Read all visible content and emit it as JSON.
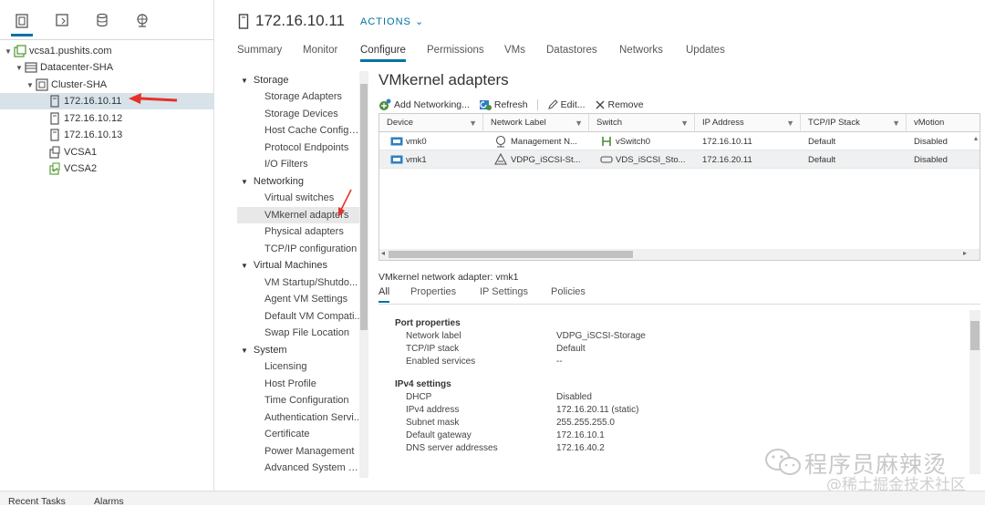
{
  "tree": {
    "vcenter": "vcsa1.pushits.com",
    "datacenter": "Datacenter-SHA",
    "cluster": "Cluster-SHA",
    "hosts": [
      "172.16.10.11",
      "172.16.10.12",
      "172.16.10.13"
    ],
    "vms": [
      "VCSA1",
      "VCSA2"
    ]
  },
  "header": {
    "title": "172.16.10.11",
    "actions": "ACTIONS"
  },
  "tabs": [
    "Summary",
    "Monitor",
    "Configure",
    "Permissions",
    "VMs",
    "Datastores",
    "Networks",
    "Updates"
  ],
  "nav": {
    "storage": {
      "label": "Storage",
      "items": [
        "Storage Adapters",
        "Storage Devices",
        "Host Cache Configur...",
        "Protocol Endpoints",
        "I/O Filters"
      ]
    },
    "networking": {
      "label": "Networking",
      "items": [
        "Virtual switches",
        "VMkernel adapters",
        "Physical adapters",
        "TCP/IP configuration"
      ]
    },
    "virtual_machines": {
      "label": "Virtual Machines",
      "items": [
        "VM Startup/Shutdo...",
        "Agent VM Settings",
        "Default VM Compati...",
        "Swap File Location"
      ]
    },
    "system": {
      "label": "System",
      "items": [
        "Licensing",
        "Host Profile",
        "Time Configuration",
        "Authentication Servi...",
        "Certificate",
        "Power Management",
        "Advanced System S..."
      ]
    }
  },
  "panel": {
    "title": "VMkernel adapters",
    "toolbar": {
      "add": "Add Networking...",
      "refresh": "Refresh",
      "edit": "Edit...",
      "remove": "Remove"
    }
  },
  "grid": {
    "columns": [
      "Device",
      "Network Label",
      "Switch",
      "IP Address",
      "TCP/IP Stack",
      "vMotion"
    ],
    "rows": [
      [
        "vmk0",
        "Management N...",
        "vSwitch0",
        "172.16.10.11",
        "Default",
        "Disabled"
      ],
      [
        "vmk1",
        "VDPG_iSCSI-St...",
        "VDS_iSCSI_Sto...",
        "172.16.20.11",
        "Default",
        "Disabled"
      ]
    ]
  },
  "detail": {
    "title": "VMkernel network adapter: vmk1",
    "tabs": [
      "All",
      "Properties",
      "IP Settings",
      "Policies"
    ],
    "port_heading": "Port properties",
    "port": [
      {
        "k": "Network label",
        "v": "VDPG_iSCSI-Storage"
      },
      {
        "k": "TCP/IP stack",
        "v": "Default"
      },
      {
        "k": "Enabled services",
        "v": "--"
      }
    ],
    "ipv4_heading": "IPv4 settings",
    "ipv4": [
      {
        "k": "DHCP",
        "v": "Disabled"
      },
      {
        "k": "IPv4 address",
        "v": "172.16.20.11 (static)"
      },
      {
        "k": "Subnet mask",
        "v": "255.255.255.0"
      },
      {
        "k": "Default gateway",
        "v": "172.16.10.1"
      },
      {
        "k": "DNS server addresses",
        "v": "172.16.40.2"
      }
    ]
  },
  "bottom": {
    "tasks": "Recent Tasks",
    "alarms": "Alarms"
  },
  "watermark": {
    "line1": "程序员麻辣烫",
    "line2": "@稀土掘金技术社区"
  },
  "colors": {
    "accent": "#0072a3",
    "arrow": "#e5312b",
    "vm_green": "#5c9e3d"
  }
}
